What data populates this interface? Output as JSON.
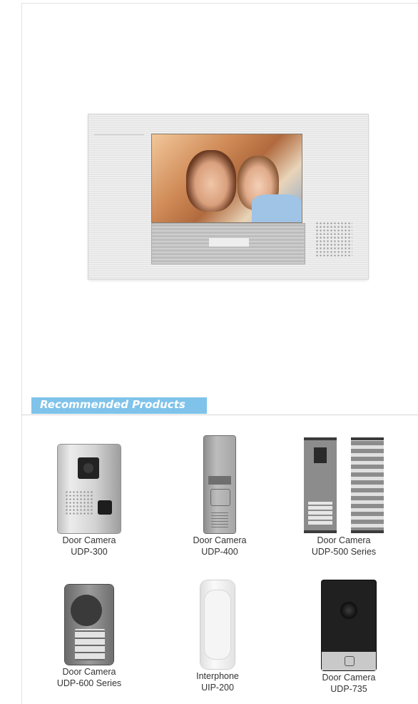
{
  "section": {
    "title": "Recommended Products"
  },
  "products": [
    {
      "name": "Door Camera",
      "model": "UDP-300"
    },
    {
      "name": "Door Camera",
      "model": "UDP-400"
    },
    {
      "name": "Door Camera",
      "model": "UDP-500 Series"
    },
    {
      "name": "Door Camera",
      "model": "UDP-600 Series"
    },
    {
      "name": "Interphone",
      "model": "UIP-200"
    },
    {
      "name": "Door Camera",
      "model": "UDP-735"
    }
  ]
}
